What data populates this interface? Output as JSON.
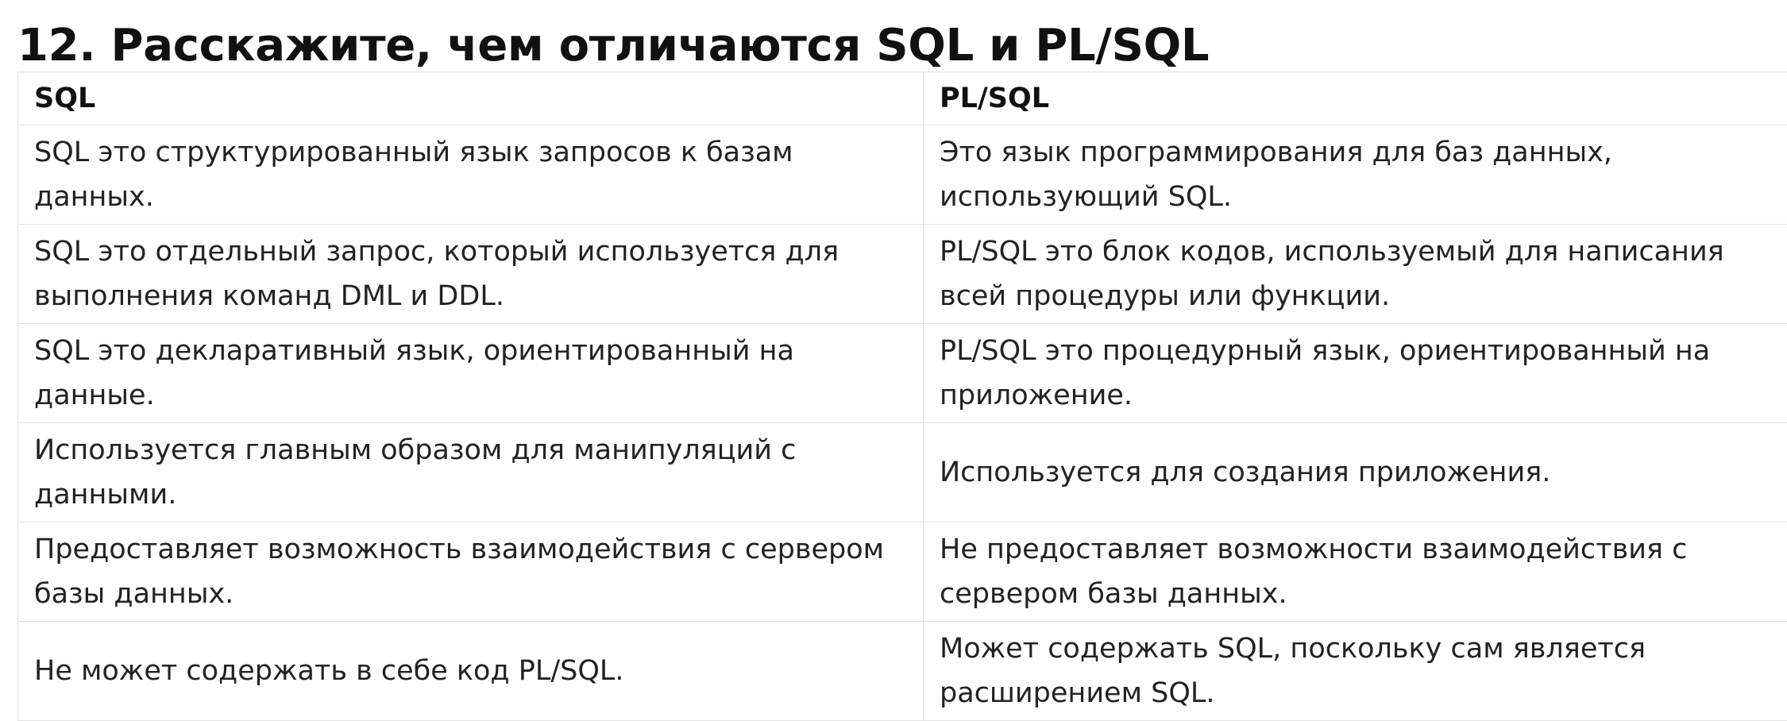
{
  "title": "12. Расскажите, чем отличаются SQL и PL/SQL",
  "table": {
    "headers": [
      "SQL",
      "PL/SQL"
    ],
    "rows": [
      [
        "SQL это структурированный язык запросов к базам данных.",
        "Это язык программирования для баз данных, использующий SQL."
      ],
      [
        "SQL это отдельный запрос, который используется для выполнения команд DML и DDL.",
        "PL/SQL это блок кодов, используемый для написания всей процедуры или функции."
      ],
      [
        "SQL это декларативный язык, ориентированный на данные.",
        "PL/SQL это процедурный язык, ориентированный на приложение."
      ],
      [
        "Используется главным образом для манипуляций с данными.",
        "Используется для создания приложения."
      ],
      [
        "Предоставляет возможность взаимодействия с сервером базы данных.",
        "Не предоставляет возможности взаимодействия с сервером базы данных."
      ],
      [
        "Не может содержать в себе код PL/SQL.",
        "Может содержать SQL, поскольку сам является расширением SQL."
      ]
    ]
  }
}
